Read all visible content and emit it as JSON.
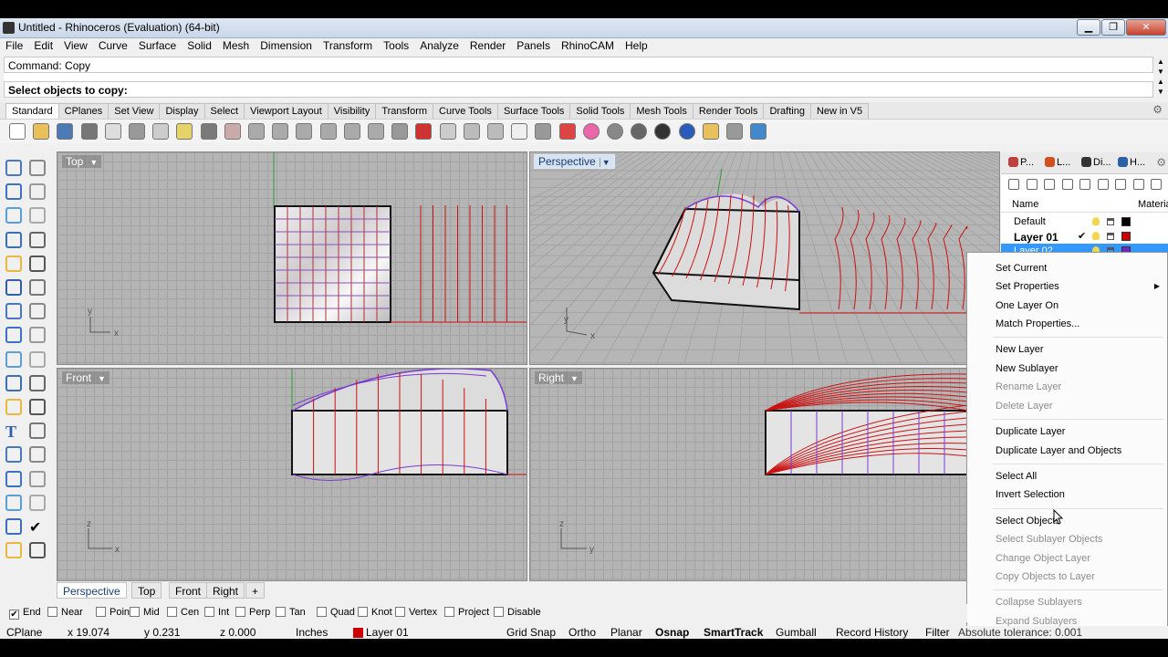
{
  "window": {
    "title": "Untitled - Rhinoceros (Evaluation) (64-bit)"
  },
  "menu": [
    "File",
    "Edit",
    "View",
    "Curve",
    "Surface",
    "Solid",
    "Mesh",
    "Dimension",
    "Transform",
    "Tools",
    "Analyze",
    "Render",
    "Panels",
    "RhinoCAM",
    "Help"
  ],
  "command": {
    "history": "Command: Copy",
    "prompt": "Select objects to copy:"
  },
  "toolbar_tabs": [
    "Standard",
    "CPlanes",
    "Set View",
    "Display",
    "Select",
    "Viewport Layout",
    "Visibility",
    "Transform",
    "Curve Tools",
    "Surface Tools",
    "Solid Tools",
    "Mesh Tools",
    "Render Tools",
    "Drafting",
    "New in V5"
  ],
  "viewports": {
    "top": {
      "label": "Top"
    },
    "perspective": {
      "label": "Perspective"
    },
    "front": {
      "label": "Front"
    },
    "right": {
      "label": "Right"
    }
  },
  "axis_labels": {
    "x": "x",
    "y": "y",
    "z": "z"
  },
  "viewport_tabs": [
    "Perspective",
    "Top",
    "Front",
    "Right"
  ],
  "add_tab_glyph": "+",
  "panel": {
    "tabs": [
      "P...",
      "L...",
      "Di...",
      "H..."
    ],
    "columns": {
      "name": "Name",
      "material": "Materia"
    },
    "layers": [
      {
        "name": "Default",
        "color": "#000000"
      },
      {
        "name": "Layer 01",
        "color": "#cc0000",
        "current": true
      },
      {
        "name": "Layer 02",
        "color": "#6a2bbf",
        "selected": true
      }
    ],
    "current_mark": "✔"
  },
  "context_menu": {
    "items": [
      {
        "label": "Set Current",
        "enabled": true
      },
      {
        "label": "Set Properties",
        "enabled": true,
        "submenu": true
      },
      {
        "label": "One Layer On",
        "enabled": true
      },
      {
        "label": "Match Properties...",
        "enabled": true
      },
      {
        "label": "New Layer",
        "enabled": true
      },
      {
        "label": "New Sublayer",
        "enabled": true
      },
      {
        "label": "Rename Layer",
        "enabled": false
      },
      {
        "label": "Delete Layer",
        "enabled": false
      },
      {
        "label": "Duplicate Layer",
        "enabled": true
      },
      {
        "label": "Duplicate Layer and Objects",
        "enabled": true
      },
      {
        "label": "Select All",
        "enabled": true
      },
      {
        "label": "Invert Selection",
        "enabled": true
      },
      {
        "label": "Select Objects",
        "enabled": true
      },
      {
        "label": "Select Sublayer Objects",
        "enabled": false
      },
      {
        "label": "Change Object Layer",
        "enabled": false
      },
      {
        "label": "Copy Objects to Layer",
        "enabled": false
      },
      {
        "label": "Collapse Sublayers",
        "enabled": false
      },
      {
        "label": "Expand Sublayers",
        "enabled": false
      }
    ]
  },
  "osnaps": [
    {
      "label": "End",
      "checked": true
    },
    {
      "label": "Near",
      "checked": false
    },
    {
      "label": "Point",
      "checked": false
    },
    {
      "label": "Mid",
      "checked": false
    },
    {
      "label": "Cen",
      "checked": false
    },
    {
      "label": "Int",
      "checked": false
    },
    {
      "label": "Perp",
      "checked": false
    },
    {
      "label": "Tan",
      "checked": false
    },
    {
      "label": "Quad",
      "checked": false
    },
    {
      "label": "Knot",
      "checked": false
    },
    {
      "label": "Vertex",
      "checked": false
    },
    {
      "label": "Project",
      "checked": false
    },
    {
      "label": "Disable",
      "checked": false
    }
  ],
  "status": {
    "cplane": "CPlane",
    "x": "x 19.074",
    "y": "y 0.231",
    "z": "z 0.000",
    "units": "Inches",
    "layer": "Layer 01",
    "layer_color": "#cc0000",
    "toggles": [
      "Grid Snap",
      "Ortho",
      "Planar",
      "Osnap",
      "SmartTrack",
      "Gumball",
      "Record History",
      "Filter"
    ],
    "tolerance": "Absolute tolerance: 0.001"
  },
  "colors": {
    "curve_red": "#cc1111",
    "iso_purple": "#7a3cd0",
    "axis_green": "#2f9a2f",
    "selection_blue": "#3399ff"
  }
}
